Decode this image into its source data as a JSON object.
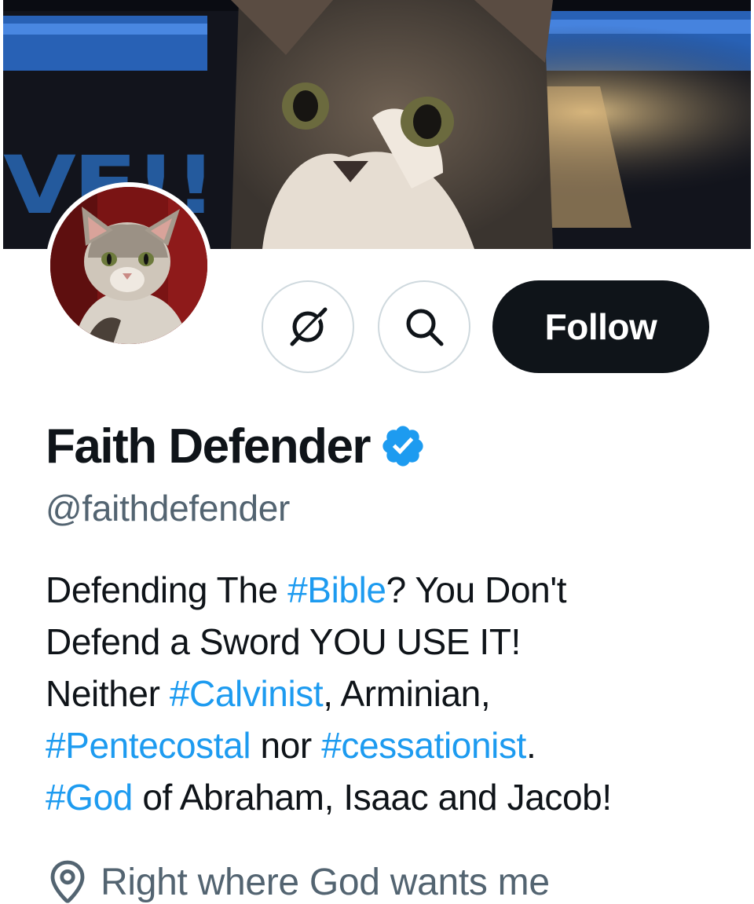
{
  "banner": {
    "text": "VE!!",
    "accent_color": "#2a72c9"
  },
  "avatar": {
    "background_color": "#7a1414"
  },
  "actions": {
    "grok_icon": "grok-icon",
    "search_icon": "search-icon",
    "follow_label": "Follow"
  },
  "profile": {
    "display_name": "Faith Defender",
    "verified": true,
    "verified_color": "#1d9bf0",
    "handle": "@faithdefender"
  },
  "bio": {
    "line1": {
      "t1": "Defending The ",
      "h1": "#Bible",
      "t2": "? You Don't"
    },
    "line2": {
      "t1": "Defend a Sword YOU USE IT!"
    },
    "line3": {
      "t1": "Neither ",
      "h1": "#Calvinist",
      "t2": ", Arminian,"
    },
    "line4": {
      "h1": "#Pentecostal",
      "t1": " nor ",
      "h2": "#cessationist",
      "t2": "."
    },
    "line5": {
      "h1": "#God",
      "t1": " of Abraham, Isaac and Jacob!"
    },
    "hashtag_color": "#1d9bf0"
  },
  "location": {
    "icon": "location-pin-icon",
    "text": "Right where God wants me"
  }
}
